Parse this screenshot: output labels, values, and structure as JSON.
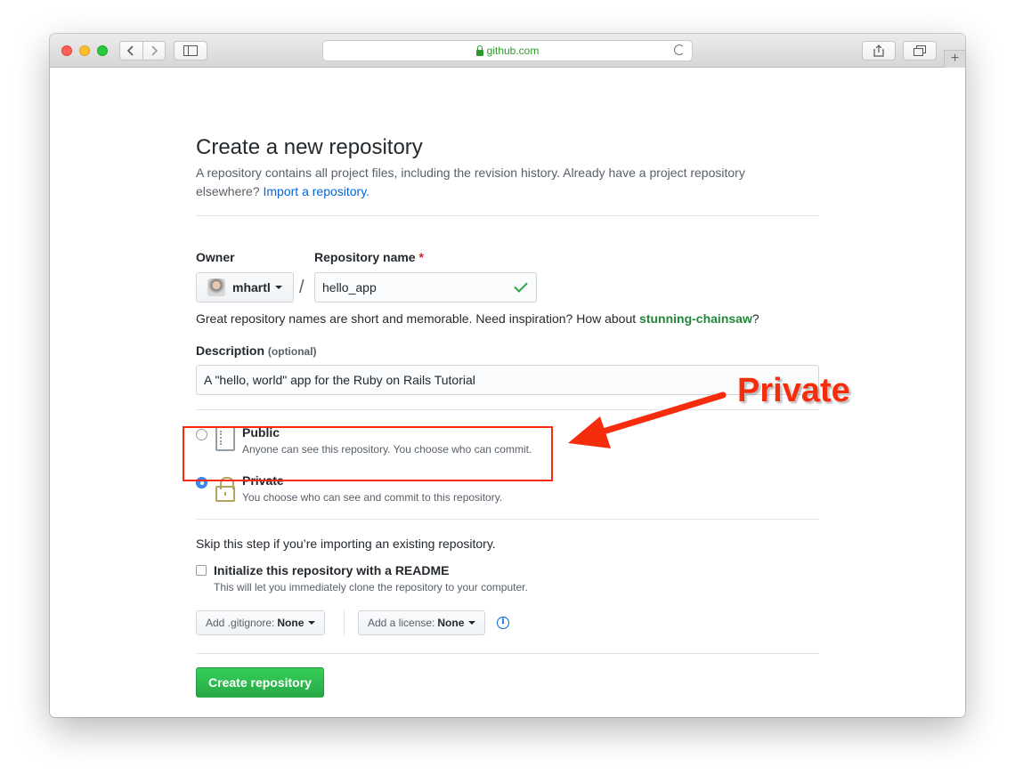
{
  "browser": {
    "url": "github.com",
    "newtab_symbol": "+"
  },
  "page": {
    "title": "Create a new repository",
    "subtitle": "A repository contains all project files, including the revision history. Already have a project repository elsewhere?",
    "import_link": "Import a repository."
  },
  "form": {
    "owner_label": "Owner",
    "owner_value": "mhartl",
    "repo_label": "Repository name",
    "required_mark": "*",
    "repo_value": "hello_app",
    "separator": "/",
    "hint_text": "Great repository names are short and memorable. Need inspiration? How about",
    "hint_suggestion": "stunning-chainsaw",
    "hint_end": "?",
    "description_label": "Description",
    "description_optional": "(optional)",
    "description_value": "A \"hello, world\" app for the Ruby on Rails Tutorial"
  },
  "visibility": {
    "public_title": "Public",
    "public_note": "Anyone can see this repository. You choose who can commit.",
    "private_title": "Private",
    "private_note": "You choose who can see and commit to this repository.",
    "selected": "private"
  },
  "init": {
    "skip_text": "Skip this step if you’re importing an existing repository.",
    "readme_label": "Initialize this repository with a README",
    "readme_note": "This will let you immediately clone the repository to your computer.",
    "readme_checked": false,
    "gitignore_label": "Add .gitignore:",
    "gitignore_value": "None",
    "license_label": "Add a license:",
    "license_value": "None",
    "info_symbol": "i"
  },
  "actions": {
    "create_label": "Create repository"
  },
  "annotation": {
    "text": "Private",
    "color": "#f52d0c"
  }
}
